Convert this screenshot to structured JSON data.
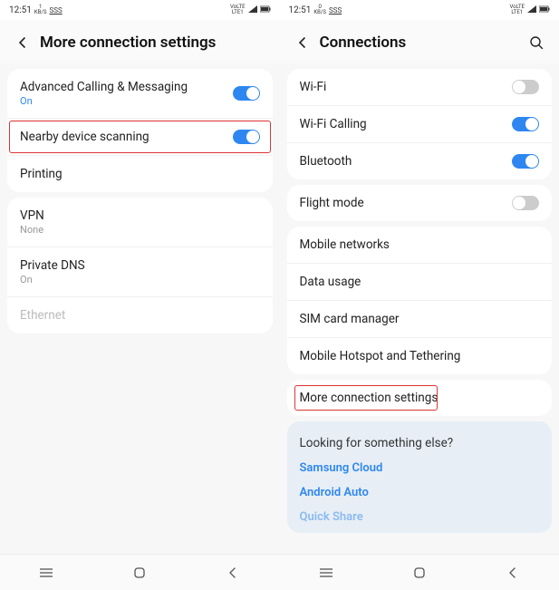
{
  "status": {
    "time": "12:51",
    "net_speed_top": "1",
    "net_speed_bot": "KB/S",
    "net_speed_top2": "0",
    "sss": "SSS",
    "vo_top": "VoLTE",
    "vo_bot": "LTE1"
  },
  "left": {
    "title": "More connection settings",
    "rows": {
      "acm": {
        "title": "Advanced Calling & Messaging",
        "sub": "On"
      },
      "nds": {
        "title": "Nearby device scanning"
      },
      "printing": {
        "title": "Printing"
      },
      "vpn": {
        "title": "VPN",
        "sub": "None"
      },
      "pdns": {
        "title": "Private DNS",
        "sub": "On"
      },
      "ethernet": {
        "title": "Ethernet"
      }
    }
  },
  "right": {
    "title": "Connections",
    "rows": {
      "wifi": {
        "title": "Wi-Fi"
      },
      "wificall": {
        "title": "Wi-Fi Calling"
      },
      "bluetooth": {
        "title": "Bluetooth"
      },
      "flight": {
        "title": "Flight mode"
      },
      "mobile_networks": {
        "title": "Mobile networks"
      },
      "data_usage": {
        "title": "Data usage"
      },
      "sim": {
        "title": "SIM card manager"
      },
      "hotspot": {
        "title": "Mobile Hotspot and Tethering"
      },
      "more": {
        "title": "More connection settings"
      }
    },
    "lookfor": {
      "title": "Looking for something else?",
      "links": [
        "Samsung Cloud",
        "Android Auto",
        "Quick Share"
      ]
    }
  },
  "toggles": {
    "acm": true,
    "nds": true,
    "wifi": false,
    "wificall": true,
    "bluetooth": true,
    "flight": false
  }
}
